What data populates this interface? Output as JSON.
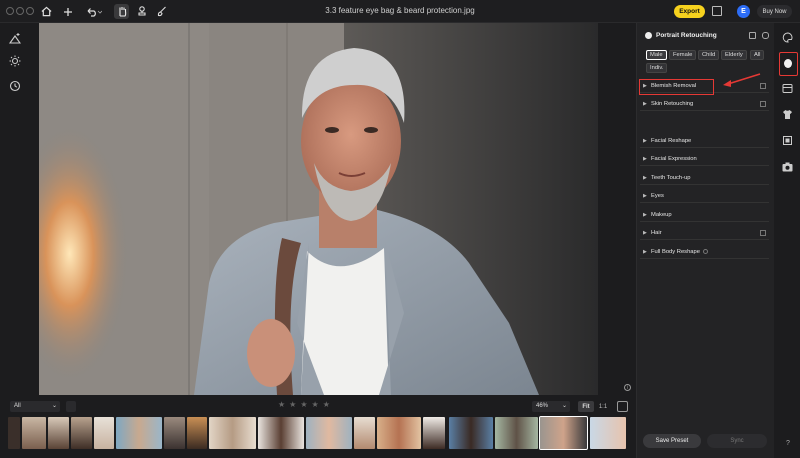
{
  "titlebar": {
    "file_name": "3.3 feature eye bag & beard protection.jpg",
    "export_label": "Export",
    "avatar_letter": "E",
    "buy_now_label": "Buy Now"
  },
  "filmstrip": {
    "filter_value": "All",
    "zoom_value": "46%",
    "fit_label": "Fit",
    "one_to_one_label": "1:1",
    "rating_stars": 5
  },
  "panel": {
    "title": "Portrait Retouching",
    "chips": [
      "Male",
      "Female",
      "Child",
      "Elderly",
      "All",
      "Indiv."
    ],
    "active_chip": "Male",
    "sections": [
      {
        "label": "Blemish Removal"
      },
      {
        "label": "Skin Retouching"
      },
      {
        "label": "Facial Reshape"
      },
      {
        "label": "Facial Expression"
      },
      {
        "label": "Teeth Touch-up"
      },
      {
        "label": "Eyes"
      },
      {
        "label": "Makeup"
      },
      {
        "label": "Hair"
      },
      {
        "label": "Full Body Reshape"
      }
    ],
    "save_preset_label": "Save Preset",
    "sync_label": "Sync"
  },
  "colors": {
    "accent_export": "#f7d21e",
    "avatar_blue": "#2d6df6",
    "annotation_red": "#e53935"
  },
  "icons": {
    "titlebar": [
      "home-icon",
      "plus-icon",
      "undo-icon",
      "hand-icon",
      "stamp-icon",
      "brush-icon"
    ],
    "left_rail": [
      "auto-enhance-icon",
      "sun-icon",
      "history-icon"
    ],
    "right_rail": [
      "palette-icon",
      "portrait-icon",
      "layers-icon",
      "shirt-icon",
      "crop-icon",
      "camera-icon"
    ]
  }
}
